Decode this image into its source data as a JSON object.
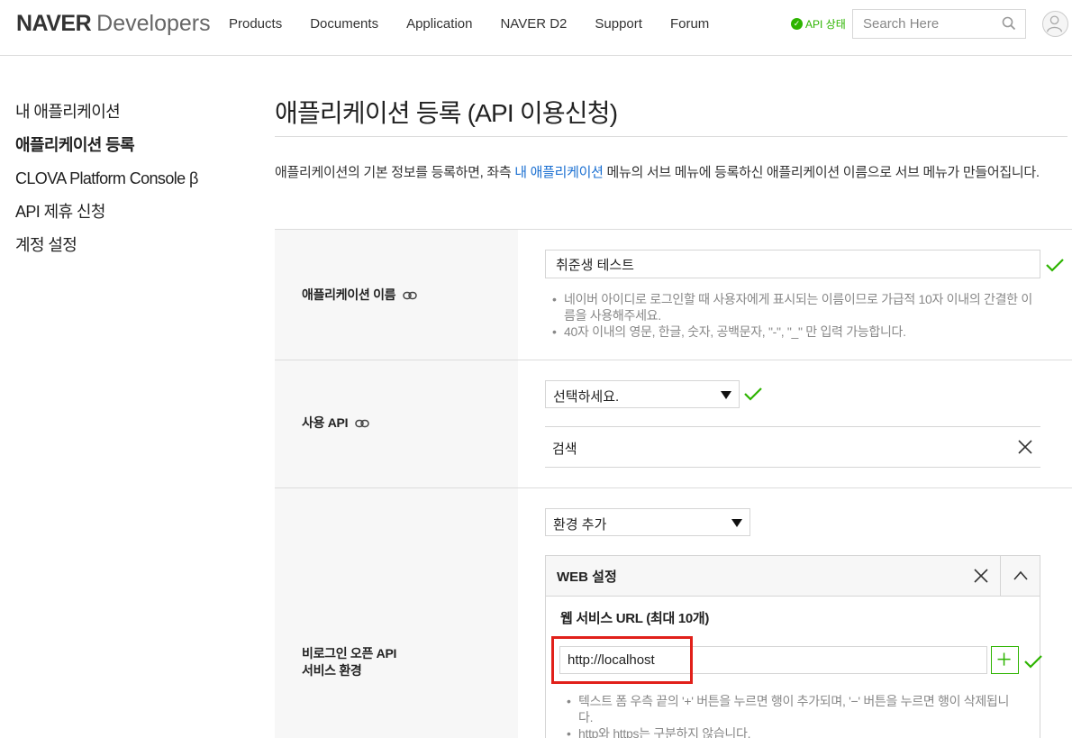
{
  "header": {
    "logo_brand": "NAVER",
    "logo_sub": "Developers",
    "nav": [
      "Products",
      "Documents",
      "Application",
      "NAVER D2",
      "Support",
      "Forum"
    ],
    "api_status": "API 상태",
    "search_placeholder": "Search Here"
  },
  "sidebar": {
    "items": [
      "내 애플리케이션",
      "애플리케이션 등록",
      "CLOVA Platform Console β",
      "API 제휴 신청",
      "계정 설정"
    ]
  },
  "main": {
    "title": "애플리케이션 등록 (API 이용신청)",
    "intro_pre": "애플리케이션의 기본 정보를 등록하면, 좌측 ",
    "intro_link": "내 애플리케이션",
    "intro_post": " 메뉴의 서브 메뉴에 등록하신 애플리케이션 이름으로 서브 메뉴가 만들어집니다."
  },
  "app_name": {
    "label": "애플리케이션 이름",
    "value": "취준생 테스트",
    "note1": "네이버 아이디로 로그인할 때 사용자에게 표시되는 이름이므로 가급적 10자 이내의 간결한 이름을 사용해주세요.",
    "note2": "40자 이내의 영문, 한글, 숫자, 공백문자, \"-\", \"_\" 만 입력 가능합니다."
  },
  "use_api": {
    "label": "사용 API",
    "select_value": "선택하세요.",
    "item": "검색"
  },
  "env": {
    "label_line1": "비로그인 오픈 API",
    "label_line2": "서비스 환경",
    "select_value": "환경 추가",
    "panel_title": "WEB 설정",
    "url_label": "웹 서비스 URL (최대 10개)",
    "url_value": "http://localhost",
    "note1": "텍스트 폼 우측 끝의 '+' 버튼을 누르면 행이 추가되며, '−' 버튼을 누르면 행이 삭제됩니다.",
    "note2": "http와 https는 구분하지 않습니다."
  },
  "colors": {
    "accent_green": "#2db400",
    "link_blue": "#1a6fd1",
    "highlight_red": "#e1201a"
  }
}
